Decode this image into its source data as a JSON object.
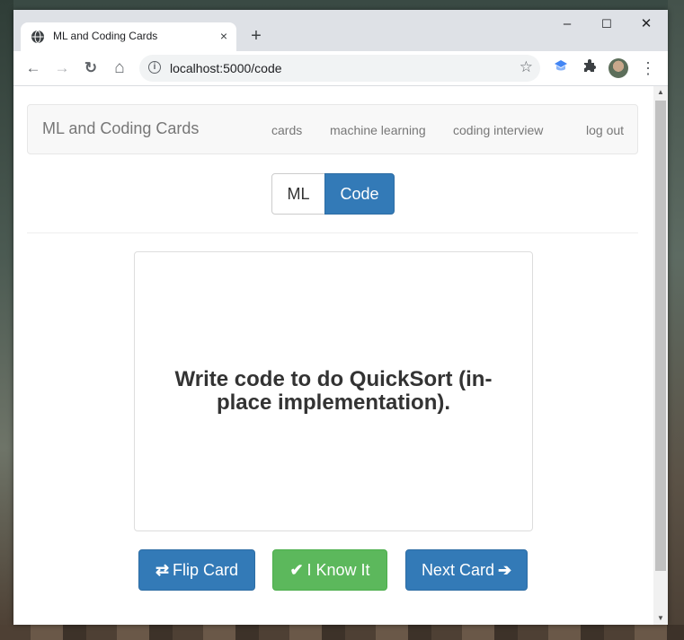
{
  "browser": {
    "tab_title": "ML and Coding Cards",
    "tab_close": "×",
    "new_tab": "+",
    "url": "localhost:5000/code",
    "window_controls": {
      "minimize": "–",
      "maximize": "☐",
      "close": "✕"
    },
    "nav": {
      "back": "←",
      "forward": "→",
      "reload": "↻",
      "home": "⌂"
    },
    "star": "☆",
    "menu": "⋮",
    "icons": [
      "globe-icon",
      "info-icon",
      "star-icon",
      "extension-shield-icon",
      "puzzle-icon",
      "profile-avatar",
      "menu-icon"
    ]
  },
  "navbar": {
    "brand": "ML and Coding Cards",
    "links": [
      "cards",
      "machine learning",
      "coding interview",
      "log out"
    ]
  },
  "toggle": {
    "options": [
      "ML",
      "Code"
    ],
    "selected": "Code"
  },
  "card": {
    "text": "Write code to do QuickSort (in-place implementation)."
  },
  "actions": {
    "flip": {
      "icon": "⇄",
      "label": "Flip Card"
    },
    "know": {
      "icon": "✔",
      "label": "I Know It"
    },
    "next": {
      "icon": "➔",
      "label": "Next Card"
    }
  },
  "colors": {
    "primary": "#337ab7",
    "success": "#5cb85c",
    "navbar_bg": "#f8f8f8",
    "text": "#333333"
  }
}
